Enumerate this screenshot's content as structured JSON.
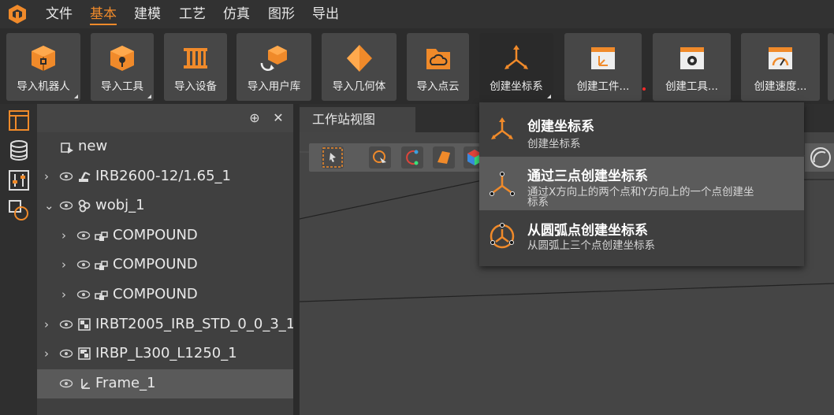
{
  "menubar": {
    "items": [
      "文件",
      "基本",
      "建模",
      "工艺",
      "仿真",
      "图形",
      "导出"
    ],
    "active_index": 1
  },
  "ribbon": {
    "buttons": [
      {
        "label": "导入机器人",
        "icon": "robot-box-icon"
      },
      {
        "label": "导入工具",
        "icon": "tool-box-icon"
      },
      {
        "label": "导入设备",
        "icon": "device-icon"
      },
      {
        "label": "导入用户库",
        "icon": "user-library-icon"
      },
      {
        "label": "导入几何体",
        "icon": "geometry-icon"
      },
      {
        "label": "导入点云",
        "icon": "point-cloud-icon"
      },
      {
        "label": "创建坐标系",
        "icon": "coordinate-frame-icon"
      },
      {
        "label": "创建工件...",
        "icon": "workpiece-frame-icon"
      },
      {
        "label": "创建工具...",
        "icon": "tool-frame-icon"
      },
      {
        "label": "创建速度...",
        "icon": "speed-gauge-icon"
      }
    ]
  },
  "tree": {
    "rows": [
      {
        "label": "new",
        "icon": "station-icon"
      },
      {
        "label": "IRB2600-12/1.65_1",
        "icon": "robot-icon"
      },
      {
        "label": "wobj_1",
        "icon": "workobject-icon"
      },
      {
        "label": "COMPOUND",
        "icon": "compound-icon"
      },
      {
        "label": "COMPOUND",
        "icon": "compound-icon"
      },
      {
        "label": "COMPOUND",
        "icon": "compound-icon"
      },
      {
        "label": "IRBT2005_IRB_STD_0_0_3_1",
        "icon": "track-icon"
      },
      {
        "label": "IRBP_L300_L1250_1",
        "icon": "positioner-icon"
      },
      {
        "label": "Frame_1",
        "icon": "frame-icon"
      }
    ]
  },
  "viewport": {
    "tab": "工作站视图"
  },
  "dropdown": {
    "items": [
      {
        "title": "创建坐标系",
        "desc": "创建坐标系",
        "icon": "coordinate-frame-icon"
      },
      {
        "title": "通过三点创建坐标系",
        "desc": "通过X方向上的两个点和Y方向上的一个点创建坐标系",
        "icon": "three-point-frame-icon"
      },
      {
        "title": "从圆弧点创建坐标系",
        "desc": "从圆弧上三个点创建坐标系",
        "icon": "arc-point-frame-icon"
      }
    ]
  },
  "colors": {
    "accent": "#f08a2a",
    "background": "#3a3a3a",
    "dropdown_hover": "#5b5b5b"
  }
}
